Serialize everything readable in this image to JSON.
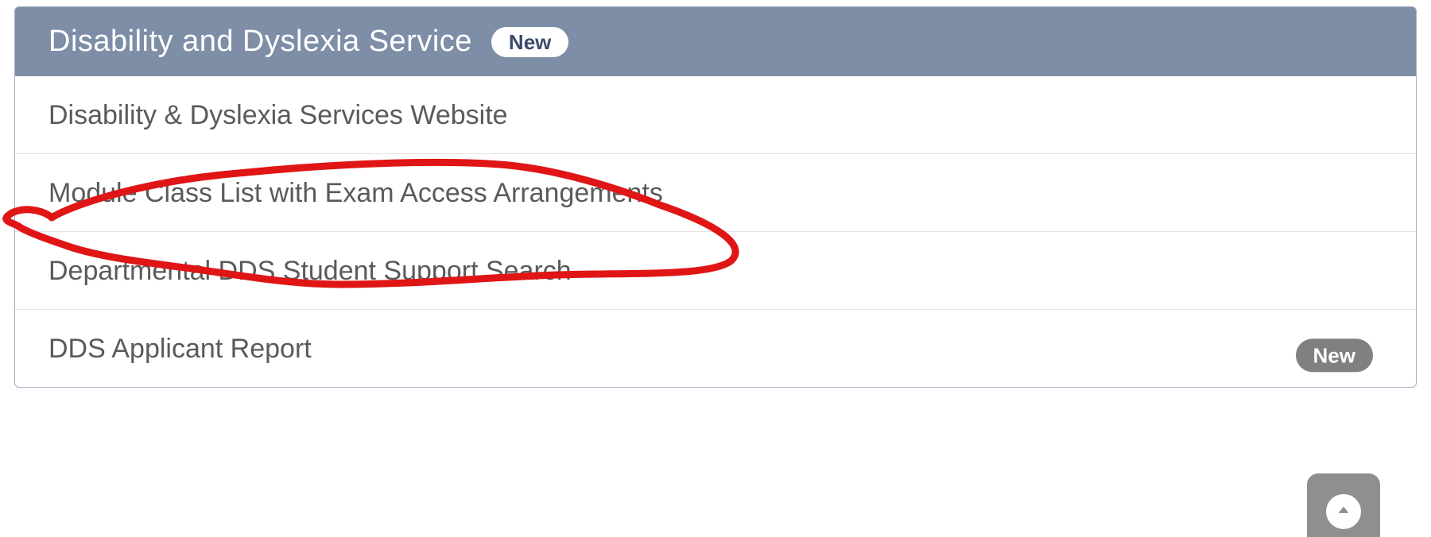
{
  "panel": {
    "title": "Disability and Dyslexia Service",
    "header_badge": "New",
    "items": [
      {
        "label": "Disability & Dyslexia Services Website",
        "badge": null
      },
      {
        "label": "Module Class List with Exam Access Arrangements",
        "badge": null
      },
      {
        "label": "Departmental DDS Student Support Search",
        "badge": null
      },
      {
        "label": "DDS Applicant Report",
        "badge": "New"
      }
    ]
  }
}
